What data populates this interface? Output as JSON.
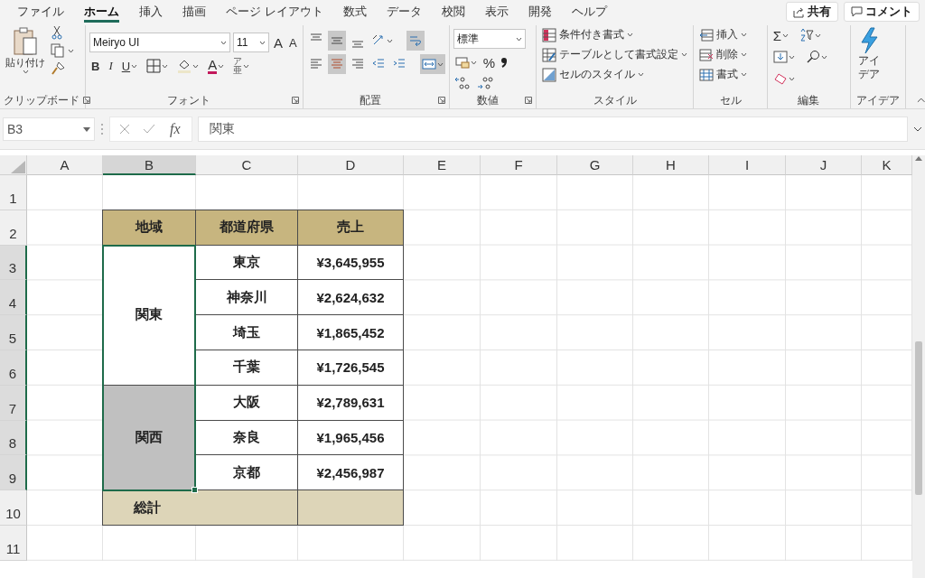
{
  "menu_tabs": [
    {
      "label": "ファイル",
      "selected": false
    },
    {
      "label": "ホーム",
      "selected": true
    },
    {
      "label": "挿入",
      "selected": false
    },
    {
      "label": "描画",
      "selected": false
    },
    {
      "label": "ページ レイアウト",
      "selected": false
    },
    {
      "label": "数式",
      "selected": false
    },
    {
      "label": "データ",
      "selected": false
    },
    {
      "label": "校閲",
      "selected": false
    },
    {
      "label": "表示",
      "selected": false
    },
    {
      "label": "開発",
      "selected": false
    },
    {
      "label": "ヘルプ",
      "selected": false
    }
  ],
  "share_button": "共有",
  "comment_button": "コメント",
  "ribbon": {
    "clipboard": {
      "paste": "貼り付け",
      "label": "クリップボード"
    },
    "font": {
      "font_name": "Meiryo UI",
      "font_size": "11",
      "grow": "A",
      "shrink": "A",
      "bold": "B",
      "italic": "I",
      "underline": "U",
      "font_color": "A",
      "phonetic": "ア亜",
      "label": "フォント"
    },
    "alignment": {
      "rows": [
        [
          {
            "kind": "top",
            "selected": false
          },
          {
            "kind": "middle",
            "selected": true
          },
          {
            "kind": "bottom",
            "selected": false
          },
          {
            "kind": "orientation",
            "selected": false
          },
          {
            "kind": "wrap",
            "selected": true
          }
        ],
        [
          {
            "kind": "left",
            "selected": false
          },
          {
            "kind": "center",
            "selected": true
          },
          {
            "kind": "right",
            "selected": false
          },
          {
            "kind": "outdent",
            "selected": false
          },
          {
            "kind": "indent",
            "selected": false
          },
          {
            "kind": "merge",
            "selected": true
          }
        ]
      ],
      "label": "配置"
    },
    "number": {
      "format": "標準",
      "percent": "%",
      "label": "数値"
    },
    "styles": {
      "items": [
        {
          "kind": "conditional",
          "label": "条件付き書式"
        },
        {
          "kind": "table",
          "label": "テーブルとして書式設定"
        },
        {
          "kind": "cellstyle",
          "label": "セルのスタイル"
        }
      ],
      "label": "スタイル"
    },
    "cells": {
      "items": [
        {
          "kind": "insert",
          "label": "挿入"
        },
        {
          "kind": "delete",
          "label": "削除"
        },
        {
          "kind": "format",
          "label": "書式"
        }
      ],
      "label": "セル"
    },
    "editing": {
      "sum": "Σ",
      "label": "編集"
    },
    "ideas": {
      "button": "アイデア",
      "label": "アイデア"
    }
  },
  "formula_bar": {
    "name_box": "B3",
    "fx": "fx",
    "formula": "関東"
  },
  "sheet": {
    "columns": [
      {
        "label": "A",
        "selected": false
      },
      {
        "label": "B",
        "selected": true
      },
      {
        "label": "C",
        "selected": false
      },
      {
        "label": "D",
        "selected": false
      },
      {
        "label": "E",
        "selected": false
      },
      {
        "label": "F",
        "selected": false
      },
      {
        "label": "G",
        "selected": false
      },
      {
        "label": "H",
        "selected": false
      },
      {
        "label": "I",
        "selected": false
      },
      {
        "label": "J",
        "selected": false
      },
      {
        "label": "K",
        "selected": false
      }
    ],
    "rows": [
      {
        "label": "1",
        "selected": false
      },
      {
        "label": "2",
        "selected": false
      },
      {
        "label": "3",
        "selected": true
      },
      {
        "label": "4",
        "selected": true
      },
      {
        "label": "5",
        "selected": true
      },
      {
        "label": "6",
        "selected": true
      },
      {
        "label": "7",
        "selected": true
      },
      {
        "label": "8",
        "selected": true
      },
      {
        "label": "9",
        "selected": true
      },
      {
        "label": "10",
        "selected": false
      },
      {
        "label": "11",
        "selected": false
      }
    ],
    "table": {
      "columns": [
        "地域",
        "都道府県",
        "売上"
      ],
      "regions": [
        {
          "name": "関東",
          "shaded": false,
          "prefectures": [
            {
              "name": "東京",
              "sales": "¥3,645,955"
            },
            {
              "name": "神奈川",
              "sales": "¥2,624,632"
            },
            {
              "name": "埼玉",
              "sales": "¥1,865,452"
            },
            {
              "name": "千葉",
              "sales": "¥1,726,545"
            }
          ]
        },
        {
          "name": "関西",
          "shaded": true,
          "prefectures": [
            {
              "name": "大阪",
              "sales": "¥2,789,631"
            },
            {
              "name": "奈良",
              "sales": "¥1,965,456"
            },
            {
              "name": "京都",
              "sales": "¥2,456,987"
            }
          ]
        }
      ],
      "total": {
        "label": "総計"
      }
    }
  }
}
